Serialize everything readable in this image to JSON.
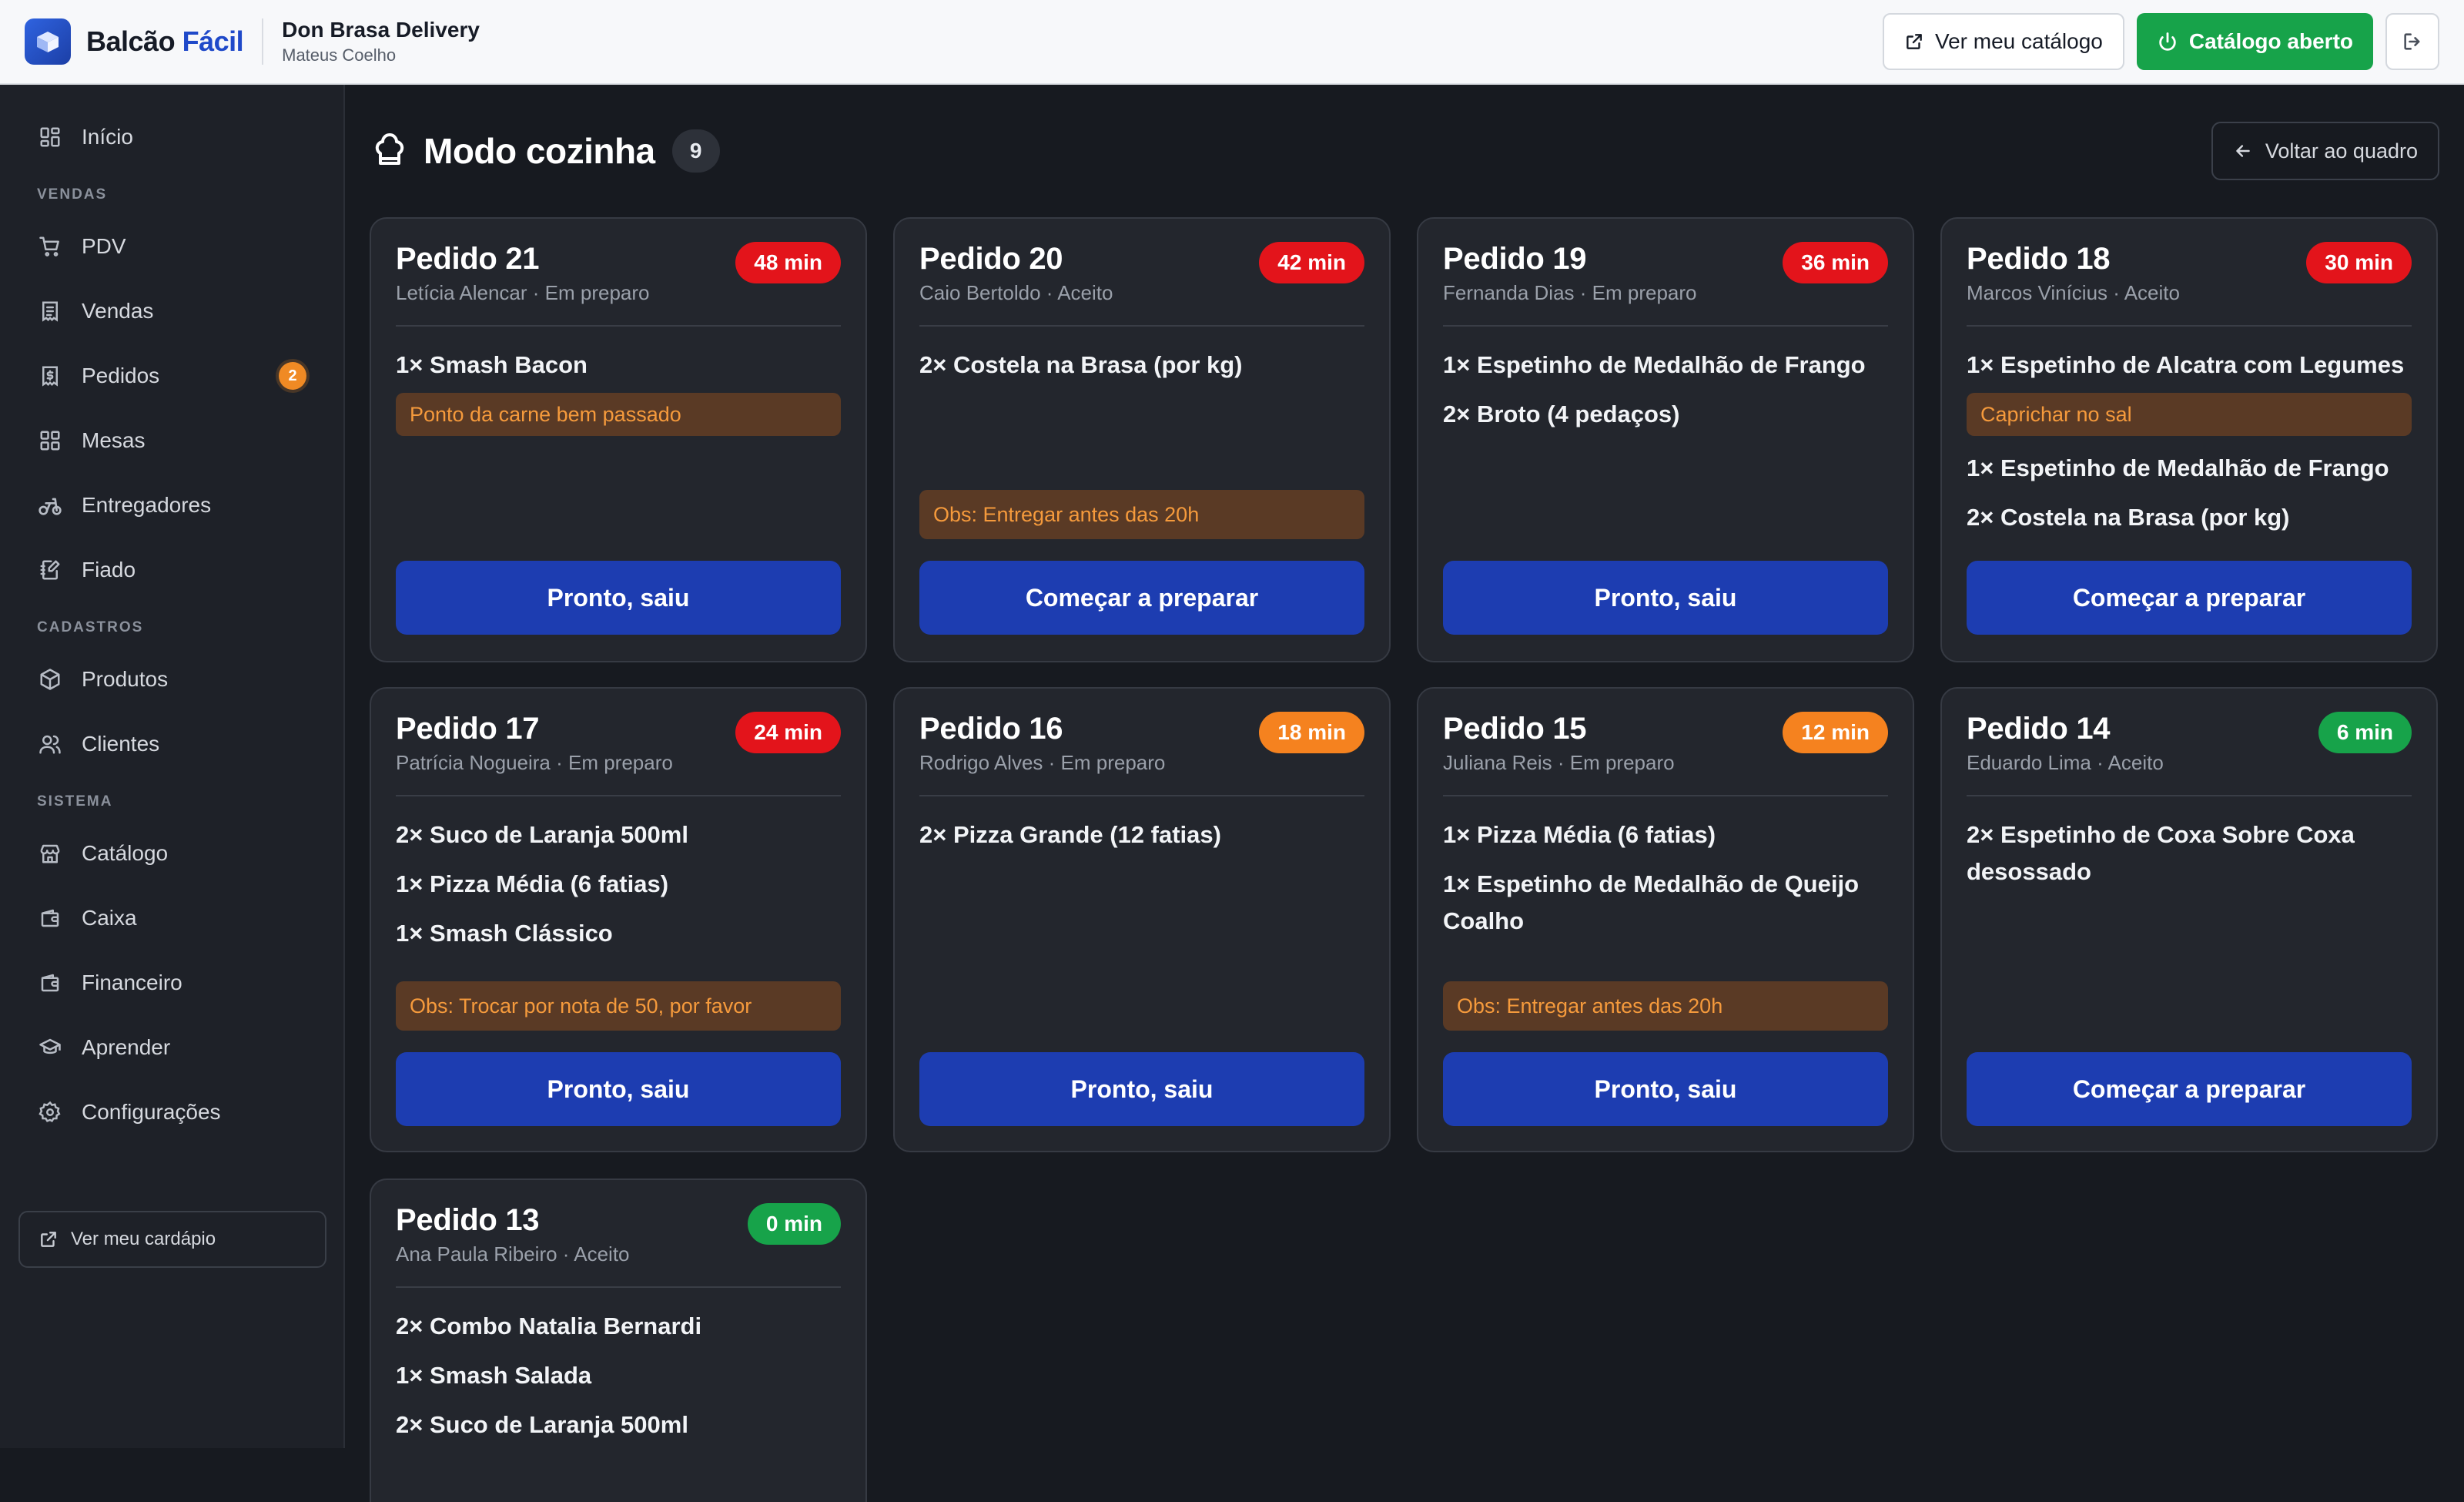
{
  "app": {
    "brand_main": "Balcão",
    "brand_accent": "Fácil",
    "store_name": "Don Brasa Delivery",
    "store_owner": "Mateus Coelho"
  },
  "topbar": {
    "catalog_button": "Ver meu catálogo",
    "status_button": "Catálogo aberto"
  },
  "sidebar": {
    "items": [
      {
        "label": "Início",
        "icon": "grid-icon"
      },
      {
        "section": "VENDAS"
      },
      {
        "label": "PDV",
        "icon": "cart-icon"
      },
      {
        "label": "Vendas",
        "icon": "receipt-icon"
      },
      {
        "label": "Pedidos",
        "icon": "dollar-receipt-icon",
        "badge": "2"
      },
      {
        "label": "Mesas",
        "icon": "grid-icon"
      },
      {
        "label": "Entregadores",
        "icon": "bike-icon"
      },
      {
        "label": "Fiado",
        "icon": "notebook-icon"
      },
      {
        "section": "CADASTROS"
      },
      {
        "label": "Produtos",
        "icon": "box-icon"
      },
      {
        "label": "Clientes",
        "icon": "users-icon"
      },
      {
        "section": "SISTEMA"
      },
      {
        "label": "Catálogo",
        "icon": "store-icon"
      },
      {
        "label": "Caixa",
        "icon": "wallet-icon"
      },
      {
        "label": "Financeiro",
        "icon": "wallet-icon"
      },
      {
        "label": "Aprender",
        "icon": "graduation-cap-icon"
      },
      {
        "label": "Configurações",
        "icon": "gear-icon"
      }
    ],
    "cta": "Ver meu cardápio"
  },
  "page": {
    "title": "Modo cozinha",
    "count": "9",
    "back_button": "Voltar ao quadro"
  },
  "colors": {
    "red": "#e3141b",
    "orange": "#f5821f",
    "green": "#17a34a",
    "primary": "#1d3db1"
  },
  "orders": [
    {
      "title": "Pedido 21",
      "time": "48 min",
      "level": "red",
      "sub": "Letícia Alencar · Em preparo",
      "items": [
        {
          "text": "1× Smash Bacon",
          "note": "Ponto da carne bem passado"
        }
      ],
      "obs": "",
      "action": "Pronto, saiu"
    },
    {
      "title": "Pedido 20",
      "time": "42 min",
      "level": "red",
      "sub": "Caio Bertoldo · Aceito",
      "items": [
        {
          "text": "2× Costela na Brasa (por kg)"
        }
      ],
      "obs": "Obs: Entregar antes das 20h",
      "action": "Começar a preparar"
    },
    {
      "title": "Pedido 19",
      "time": "36 min",
      "level": "red",
      "sub": "Fernanda Dias · Em preparo",
      "items": [
        {
          "text": "1× Espetinho de Medalhão de Frango"
        },
        {
          "text": "2× Broto (4 pedaços)"
        }
      ],
      "obs": "",
      "action": "Pronto, saiu"
    },
    {
      "title": "Pedido 18",
      "time": "30 min",
      "level": "red",
      "sub": "Marcos Vinícius · Aceito",
      "items": [
        {
          "text": "1× Espetinho de Alcatra com Legumes",
          "note": "Caprichar no sal"
        },
        {
          "text": "1× Espetinho de Medalhão de Frango"
        },
        {
          "text": "2× Costela na Brasa (por kg)"
        }
      ],
      "obs": "",
      "action": "Começar a preparar"
    },
    {
      "title": "Pedido 17",
      "time": "24 min",
      "level": "red",
      "sub": "Patrícia Nogueira · Em preparo",
      "items": [
        {
          "text": "2× Suco de Laranja 500ml"
        },
        {
          "text": "1× Pizza Média (6 fatias)"
        },
        {
          "text": "1× Smash Clássico"
        }
      ],
      "obs": "Obs: Trocar por nota de 50, por favor",
      "action": "Pronto, saiu"
    },
    {
      "title": "Pedido 16",
      "time": "18 min",
      "level": "orange",
      "sub": "Rodrigo Alves · Em preparo",
      "items": [
        {
          "text": "2× Pizza Grande (12 fatias)"
        }
      ],
      "obs": "",
      "action": "Pronto, saiu"
    },
    {
      "title": "Pedido 15",
      "time": "12 min",
      "level": "orange",
      "sub": "Juliana Reis · Em preparo",
      "items": [
        {
          "text": "1× Pizza Média (6 fatias)"
        },
        {
          "text": "1× Espetinho de Medalhão de Queijo Coalho"
        }
      ],
      "obs": "Obs: Entregar antes das 20h",
      "action": "Pronto, saiu"
    },
    {
      "title": "Pedido 14",
      "time": "6 min",
      "level": "green",
      "sub": "Eduardo Lima · Aceito",
      "items": [
        {
          "text": "2× Espetinho de Coxa Sobre Coxa desossado"
        }
      ],
      "obs": "",
      "action": "Começar a preparar"
    },
    {
      "title": "Pedido 13",
      "time": "0 min",
      "level": "green",
      "sub": "Ana Paula Ribeiro · Aceito",
      "items": [
        {
          "text": "2× Combo Natalia Bernardi"
        },
        {
          "text": "1× Smash Salada"
        },
        {
          "text": "2× Suco de Laranja 500ml"
        }
      ],
      "obs": "",
      "action": ""
    }
  ]
}
